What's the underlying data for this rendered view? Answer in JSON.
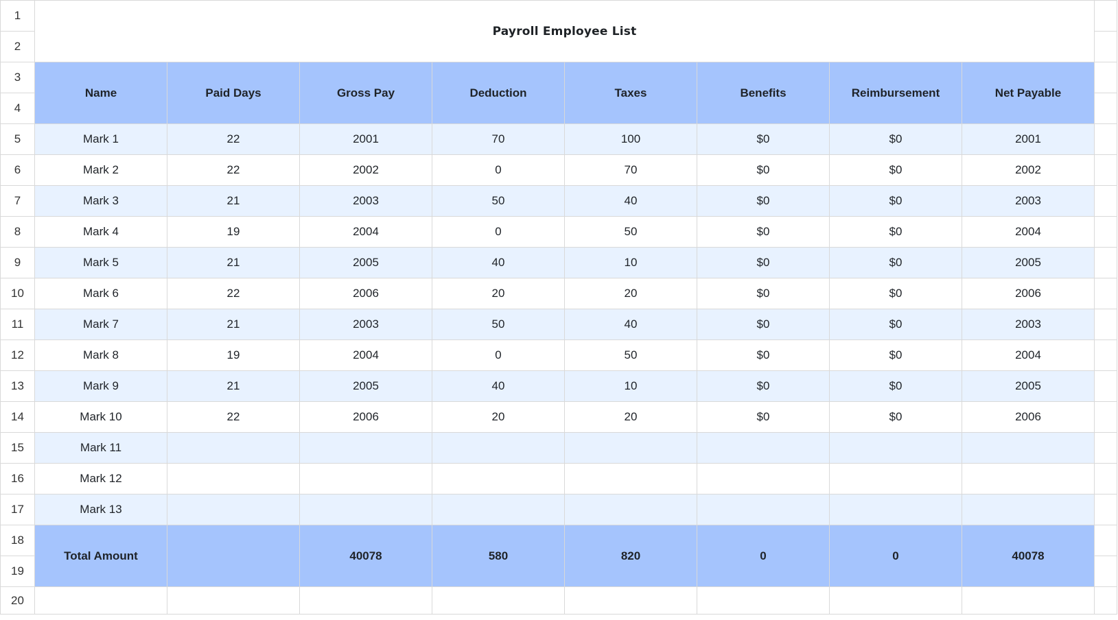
{
  "title": "Payroll Employee List",
  "row_numbers": [
    "1",
    "2",
    "3",
    "4",
    "5",
    "6",
    "7",
    "8",
    "9",
    "10",
    "11",
    "12",
    "13",
    "14",
    "15",
    "16",
    "17",
    "18",
    "19",
    "20"
  ],
  "headers": [
    "Name",
    "Paid Days",
    "Gross Pay",
    "Deduction",
    "Taxes",
    "Benefits",
    "Reimbursement",
    "Net Payable"
  ],
  "rows": [
    [
      "Mark 1",
      "22",
      "2001",
      "70",
      "100",
      "$0",
      "$0",
      "2001"
    ],
    [
      "Mark 2",
      "22",
      "2002",
      "0",
      "70",
      "$0",
      "$0",
      "2002"
    ],
    [
      "Mark 3",
      "21",
      "2003",
      "50",
      "40",
      "$0",
      "$0",
      "2003"
    ],
    [
      "Mark 4",
      "19",
      "2004",
      "0",
      "50",
      "$0",
      "$0",
      "2004"
    ],
    [
      "Mark 5",
      "21",
      "2005",
      "40",
      "10",
      "$0",
      "$0",
      "2005"
    ],
    [
      "Mark 6",
      "22",
      "2006",
      "20",
      "20",
      "$0",
      "$0",
      "2006"
    ],
    [
      "Mark 7",
      "21",
      "2003",
      "50",
      "40",
      "$0",
      "$0",
      "2003"
    ],
    [
      "Mark 8",
      "19",
      "2004",
      "0",
      "50",
      "$0",
      "$0",
      "2004"
    ],
    [
      "Mark 9",
      "21",
      "2005",
      "40",
      "10",
      "$0",
      "$0",
      "2005"
    ],
    [
      "Mark 10",
      "22",
      "2006",
      "20",
      "20",
      "$0",
      "$0",
      "2006"
    ],
    [
      "Mark 11",
      "",
      "",
      "",
      "",
      "",
      "",
      ""
    ],
    [
      "Mark 12",
      "",
      "",
      "",
      "",
      "",
      "",
      ""
    ],
    [
      "Mark 13",
      "",
      "",
      "",
      "",
      "",
      "",
      ""
    ]
  ],
  "totals": [
    "Total Amount",
    "",
    "40078",
    "580",
    "820",
    "0",
    "0",
    "40078"
  ],
  "colors": {
    "header_bg": "#a5c4fd",
    "stripe_bg": "#e8f2ff",
    "grid_line": "#d9d9d9"
  }
}
